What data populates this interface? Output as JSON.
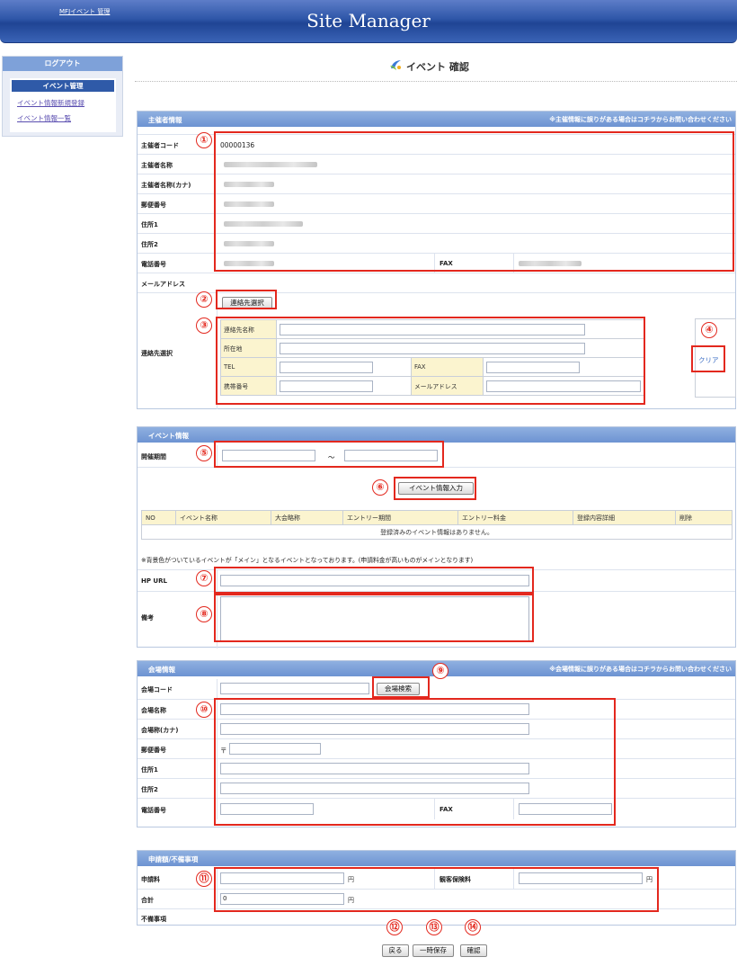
{
  "header": {
    "admin_link": "MFJイベント 管理",
    "site_title": "Site Manager"
  },
  "sidebar": {
    "logout": "ログアウト",
    "section_title": "イベント管理",
    "links": [
      "イベント情報新規登録",
      "イベント情報一覧"
    ]
  },
  "page": {
    "title": "イベント 確認"
  },
  "organizer": {
    "header": "主催者情報",
    "notice": "※主催情報に誤りがある場合はコチラからお問い合わせください",
    "labels": {
      "code": "主催者コード",
      "name": "主催者名称",
      "name_kana": "主催者名称(カナ)",
      "postal": "郵便番号",
      "address1": "住所1",
      "address2": "住所2",
      "phone": "電話番号",
      "fax": "FAX",
      "email": "メールアドレス",
      "contact_select": "連絡先選択"
    },
    "code_value": "00000136",
    "contact_select_button": "連絡先選択",
    "contact_labels": {
      "name": "連絡先名称",
      "location": "所在地",
      "tel": "TEL",
      "fax": "FAX",
      "mobile": "携帯番号",
      "email": "メールアドレス"
    },
    "clear_link": "クリア"
  },
  "event": {
    "header": "イベント情報",
    "period_label": "開催期間",
    "tilde": "～",
    "input_button": "イベント情報入力",
    "table_headers": [
      "NO",
      "イベント名称",
      "大会略称",
      "エントリー期間",
      "エントリー料金",
      "登録内容詳細",
      "削除"
    ],
    "empty_message": "登録済みのイベント情報はありません。",
    "note": "※背景色がついているイベントが「メイン」となるイベントとなっております。(申請料金が高いものがメインとなります)",
    "hp_url_label": "HP URL",
    "remarks_label": "備考"
  },
  "venue": {
    "header": "会場情報",
    "notice": "※会場情報に誤りがある場合はコチラからお問い合わせください",
    "labels": {
      "code": "会場コード",
      "name": "会場名称",
      "name_kana": "会場称(カナ)",
      "postal": "郵便番号",
      "address1": "住所1",
      "address2": "住所2",
      "phone": "電話番号",
      "fax": "FAX"
    },
    "search_button": "会場検索",
    "postal_prefix": "〒"
  },
  "fees": {
    "header": "申請額/不備事項",
    "application_fee_label": "申請料",
    "insurance_label": "観客保険料",
    "total_label": "合計",
    "total_value": "0",
    "yen": "円",
    "defects_label": "不備事項"
  },
  "actions": {
    "back": "戻る",
    "save_draft": "一時保存",
    "confirm": "確認"
  },
  "annotations": [
    "①",
    "②",
    "③",
    "④",
    "⑤",
    "⑥",
    "⑦",
    "⑧",
    "⑨",
    "⑩",
    "⑪",
    "⑫",
    "⑬",
    "⑭"
  ],
  "colors": {
    "accent_red": "#e3281e",
    "header_blue": "#2e56a8",
    "label_yellow": "#fbf4cf"
  }
}
